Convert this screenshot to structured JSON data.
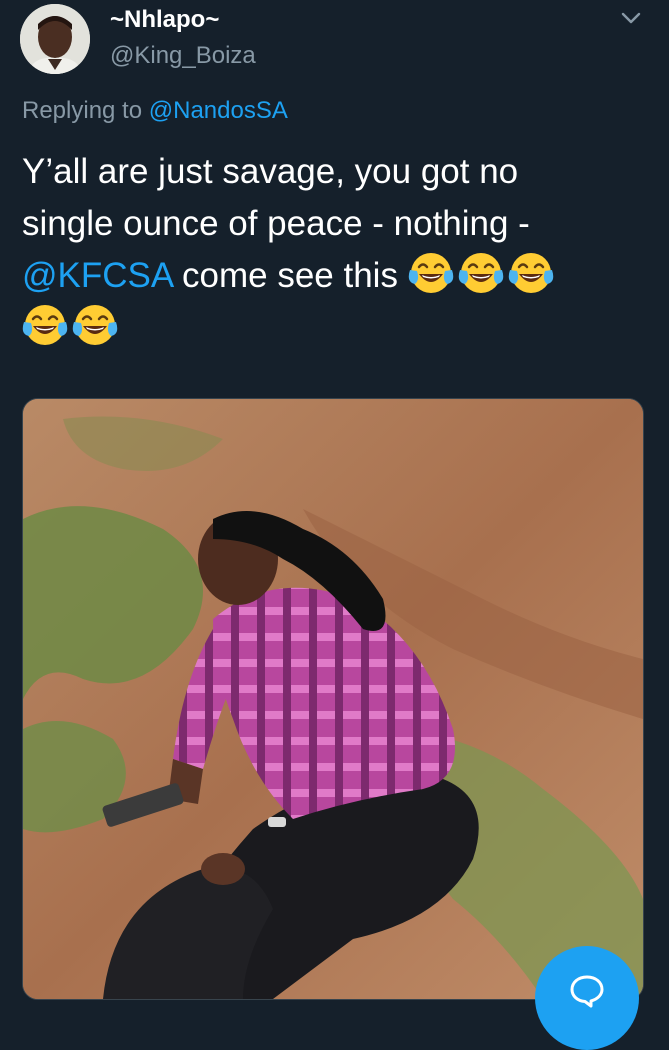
{
  "tweet": {
    "display_name": "~Nhlapo~",
    "handle": "@King_Boiza",
    "replying_prefix": "Replying to",
    "replying_to": "@NandosSA",
    "text_line1": "Y’all are just savage, you got no",
    "text_line2": "single ounce of peace - nothing -",
    "text_mention": "@KFCSA",
    "text_line3_rest": " come see this ",
    "emoji": "face-with-tears-of-joy",
    "emoji_count": 5
  },
  "icons": {
    "chevron": "chevron-down-icon",
    "compose": "reply-bubble-icon"
  },
  "colors": {
    "background": "#15202b",
    "accent": "#1da1f2",
    "secondary_text": "#8899a6"
  }
}
